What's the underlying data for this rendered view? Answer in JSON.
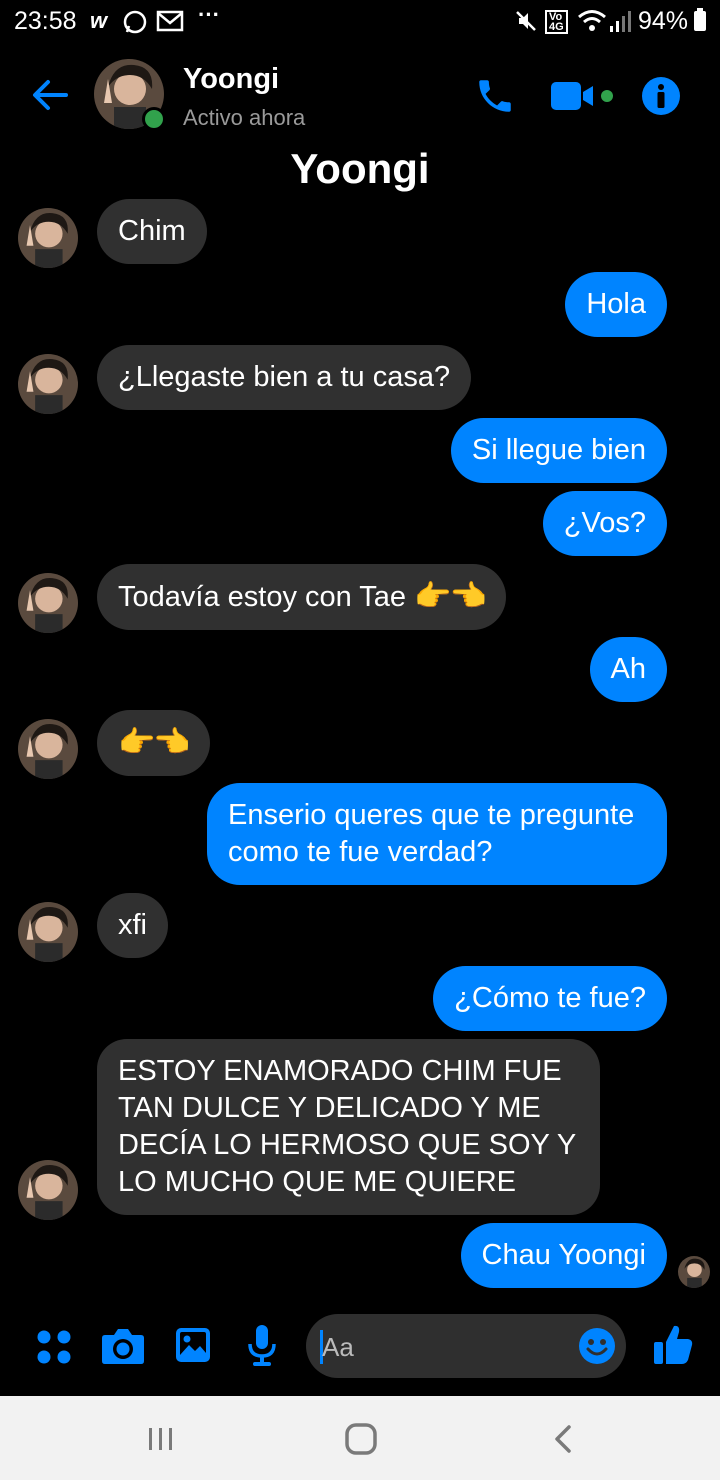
{
  "status_bar": {
    "time": "23:58",
    "notification_icons": [
      "w",
      "whatsapp-icon",
      "gmail-icon",
      "more-dots"
    ],
    "battery": "94%"
  },
  "header": {
    "contact_name": "Yoongi",
    "contact_status": "Activo ahora"
  },
  "conversation_title": "Yoongi",
  "messages": [
    {
      "from": "them",
      "text": "Chim"
    },
    {
      "from": "me",
      "text": "Hola"
    },
    {
      "from": "them",
      "text": "¿Llegaste bien a tu casa?"
    },
    {
      "from": "me",
      "text": "Si llegue bien"
    },
    {
      "from": "me",
      "text": "¿Vos?"
    },
    {
      "from": "them",
      "text": "Todavía estoy con Tae",
      "emoji": "👉👈"
    },
    {
      "from": "me",
      "text": "Ah"
    },
    {
      "from": "them",
      "text": "👉👈"
    },
    {
      "from": "me",
      "text": "Enserio queres que te pregunte como te fue verdad?"
    },
    {
      "from": "them",
      "text": "xfi"
    },
    {
      "from": "me",
      "text": "¿Cómo te fue?"
    },
    {
      "from": "them",
      "text": "ESTOY ENAMORADO CHIM FUE TAN DULCE Y DELICADO Y ME DECÍA LO HERMOSO QUE SOY Y LO MUCHO QUE ME QUIERE"
    },
    {
      "from": "me",
      "text": "Chau Yoongi"
    }
  ],
  "composer": {
    "placeholder": "Aa"
  },
  "colors": {
    "accent": "#0084ff",
    "incoming_bubble": "#303030",
    "background": "#000000",
    "online": "#31a24c"
  }
}
